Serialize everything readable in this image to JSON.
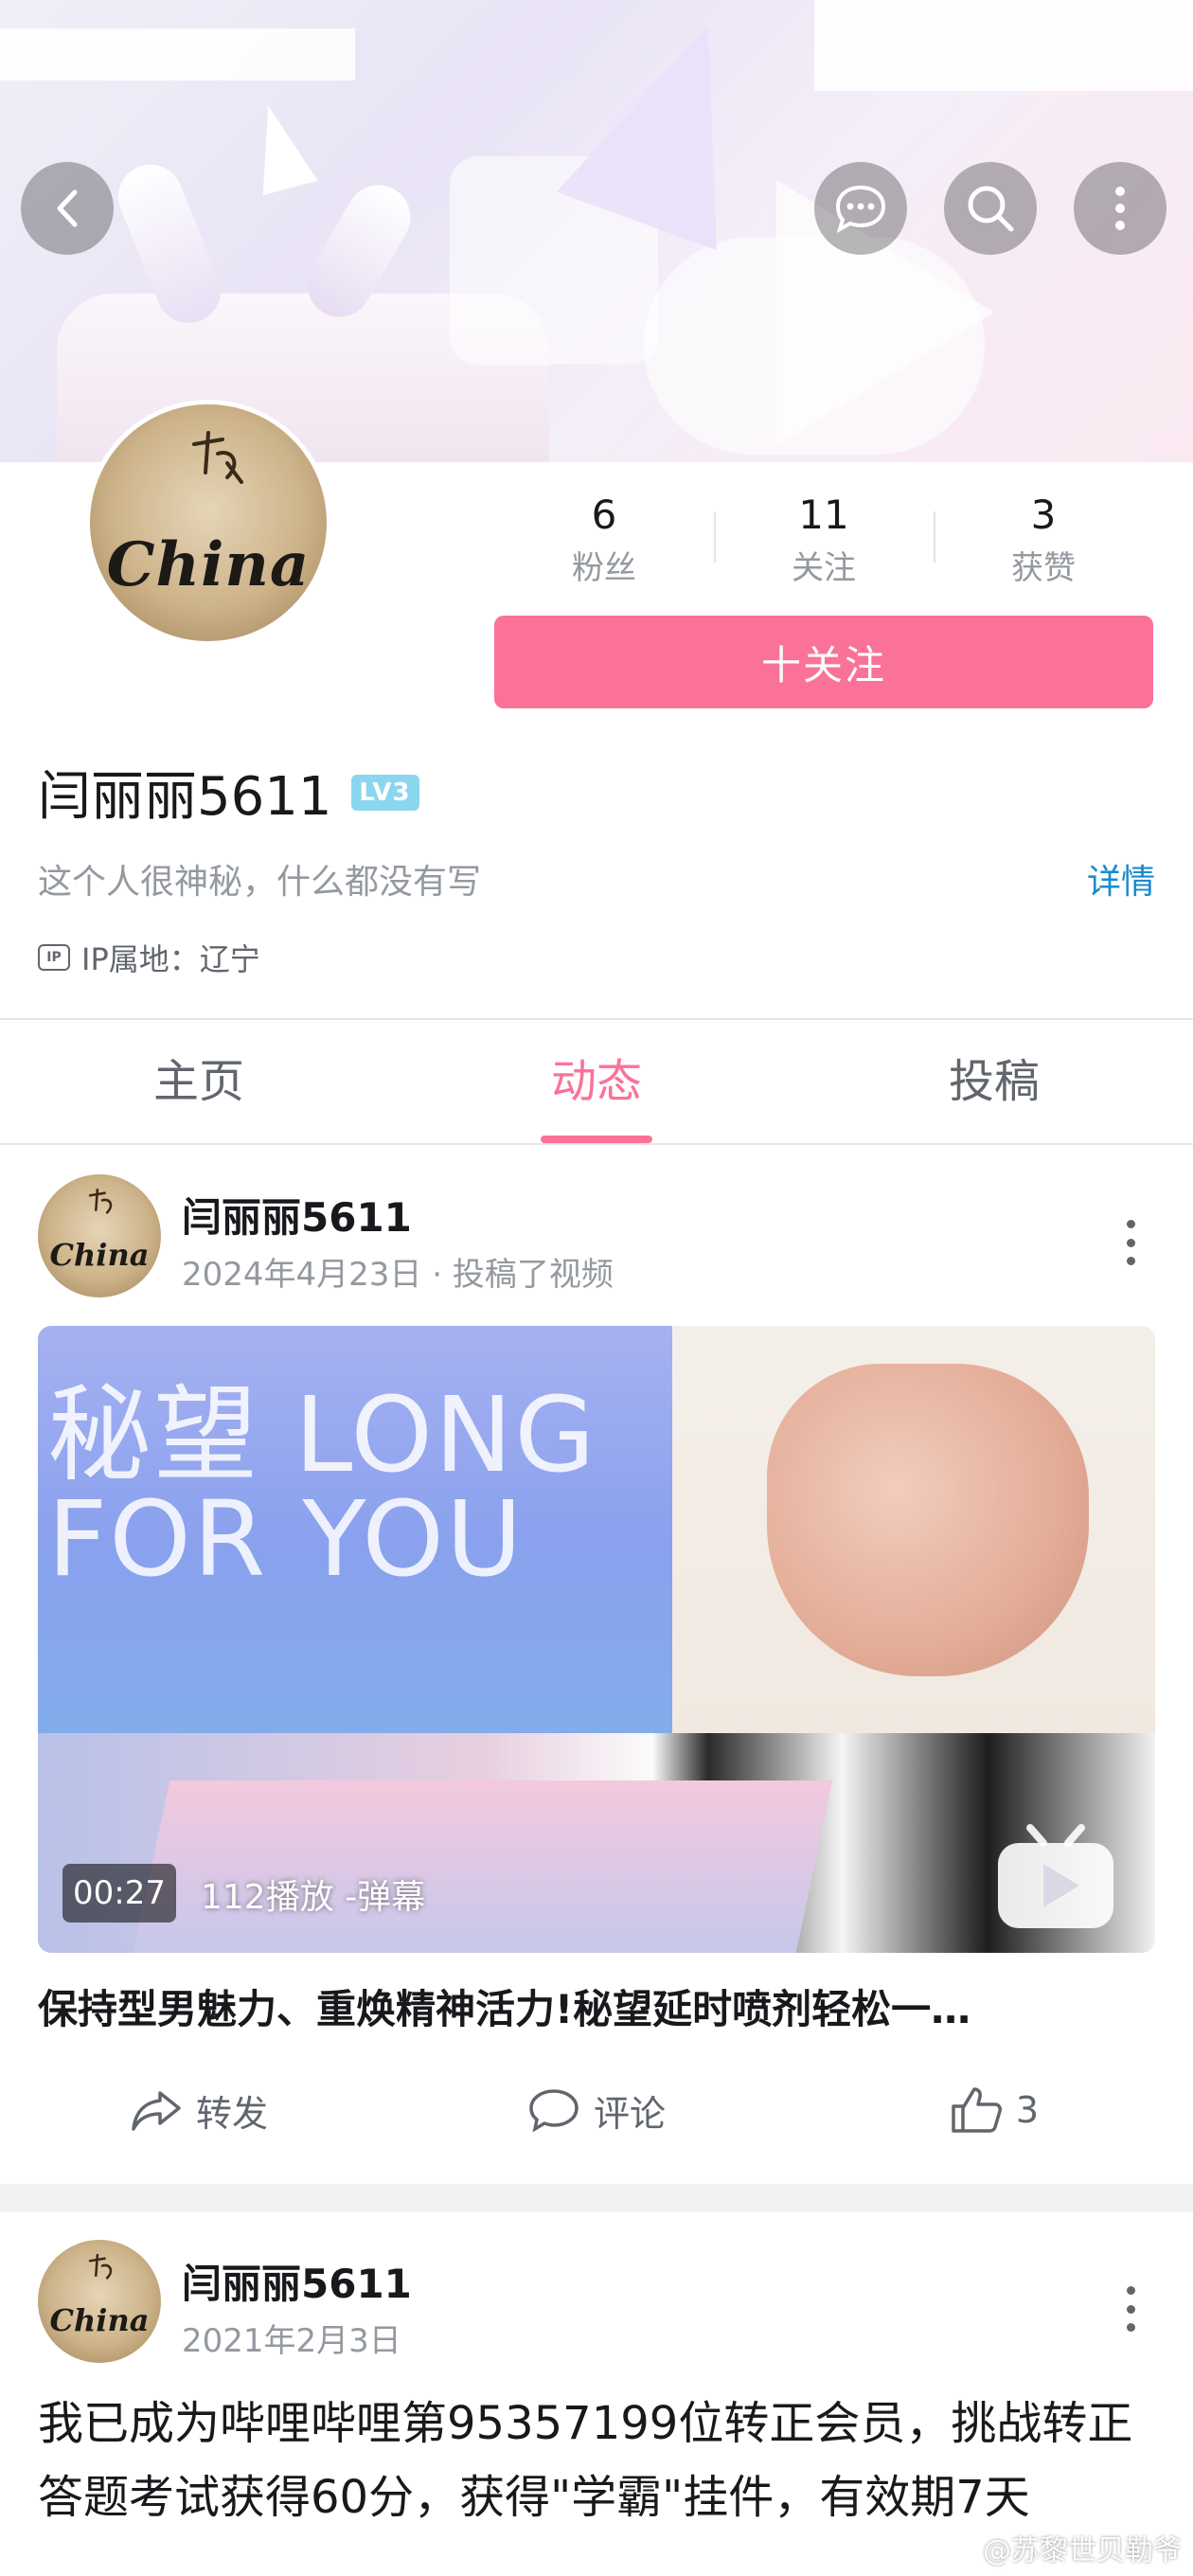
{
  "banner": {
    "alt": ""
  },
  "header": {
    "back_icon": "chevron-left-icon",
    "chat_icon": "chat-bubble-icon",
    "search_icon": "search-icon",
    "more_icon": "more-vertical-icon"
  },
  "profile": {
    "avatar_text": "China",
    "stats": [
      {
        "value": "6",
        "label": "粉丝"
      },
      {
        "value": "11",
        "label": "关注"
      },
      {
        "value": "3",
        "label": "获赞"
      }
    ],
    "follow_label": "十关注",
    "username": "闫丽丽5611",
    "level": "LV3",
    "bio": "这个人很神秘，什么都没有写",
    "detail_link": "详情",
    "ip_badge": "IP",
    "ip_location": "IP属地：辽宁"
  },
  "tabs": [
    {
      "label": "主页",
      "active": false
    },
    {
      "label": "动态",
      "active": true
    },
    {
      "label": "投稿",
      "active": false
    }
  ],
  "feed": [
    {
      "author": "闫丽丽5611",
      "meta": "2024年4月23日 · 投稿了视频",
      "video": {
        "overlay_text": "秘望 LONG FOR YOU",
        "duration": "00:27",
        "stats": "112播放  -弹幕"
      },
      "title": "保持型男魅力、重焕精神活力!秘望延时喷剂轻松一…",
      "actions": [
        {
          "label": "转发",
          "icon": "share-icon"
        },
        {
          "label": "评论",
          "icon": "comment-icon"
        },
        {
          "label": "3",
          "icon": "thumbs-up-icon"
        }
      ]
    },
    {
      "author": "闫丽丽5611",
      "meta": "2021年2月3日",
      "text": "我已成为哔哩哔哩第95357199位转正会员，挑战转正答题考试获得60分，获得\"学霸\"挂件，有效期7天"
    }
  ],
  "watermark": "@苏黎世贝勒爷",
  "colors": {
    "accent": "#fb7299",
    "link": "#178bcf",
    "level_badge": "#8ad6ef"
  }
}
